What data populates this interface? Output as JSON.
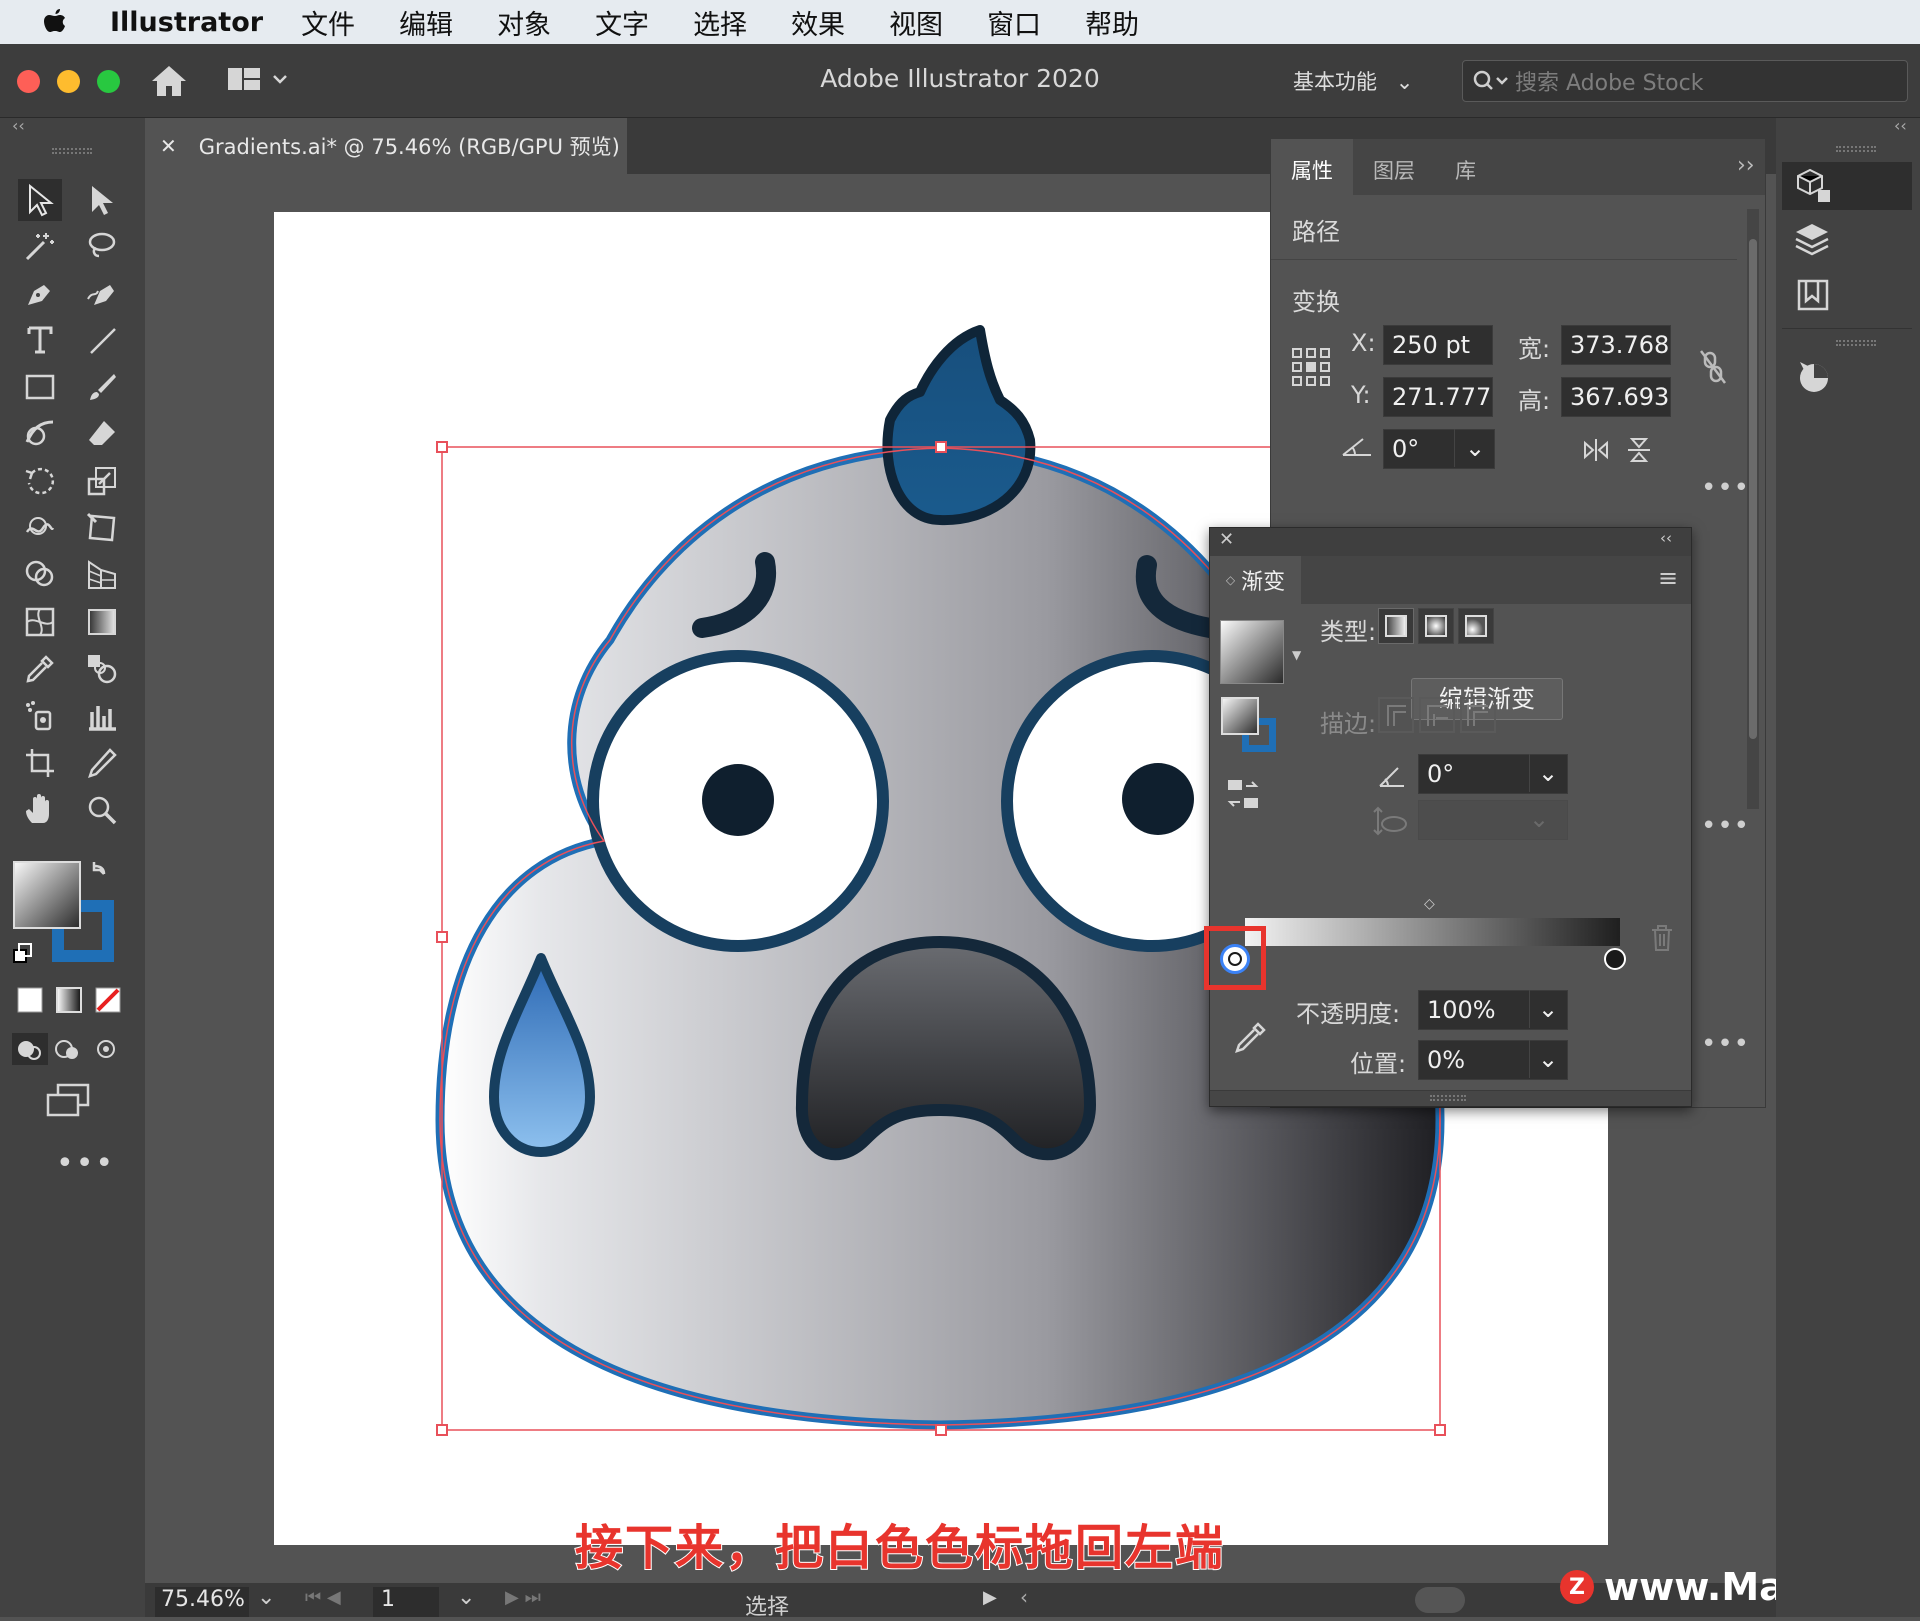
{
  "menubar": {
    "app": "Illustrator",
    "items": [
      "文件",
      "编辑",
      "对象",
      "文字",
      "选择",
      "效果",
      "视图",
      "窗口",
      "帮助"
    ]
  },
  "appbar": {
    "title": "Adobe Illustrator 2020",
    "workspace": "基本功能",
    "search_placeholder": "搜索 Adobe Stock"
  },
  "document": {
    "tab_title": "Gradients.ai* @ 75.46% (RGB/GPU 预览)"
  },
  "properties": {
    "tabs": [
      "属性",
      "图层",
      "库"
    ],
    "object_type": "路径",
    "transform_title": "变换",
    "x_label": "X:",
    "x": "250 pt",
    "y_label": "Y:",
    "y": "271.777",
    "w_label": "宽:",
    "w": "373.768",
    "h_label": "高:",
    "h": "367.693",
    "angle": "0°"
  },
  "gradient": {
    "title": "渐变",
    "type_label": "类型:",
    "edit_button": "编辑渐变",
    "stroke_label": "描边:",
    "angle": "0°",
    "opacity_label": "不透明度:",
    "opacity": "100%",
    "location_label": "位置:",
    "location": "0%",
    "colors": {
      "start": "#f2f2f2",
      "end": "#1f1f1f"
    }
  },
  "status": {
    "zoom": "75.46%",
    "page": "1",
    "tool": "选择"
  },
  "subtitle": "接下来，把白色色标拖回左端",
  "watermark": "www.MacZ.com",
  "colors": {
    "accent": "#e8342d",
    "selection": "#e8505a",
    "outline": "#173f5f",
    "stroke_blue": "#1f6fb6"
  }
}
